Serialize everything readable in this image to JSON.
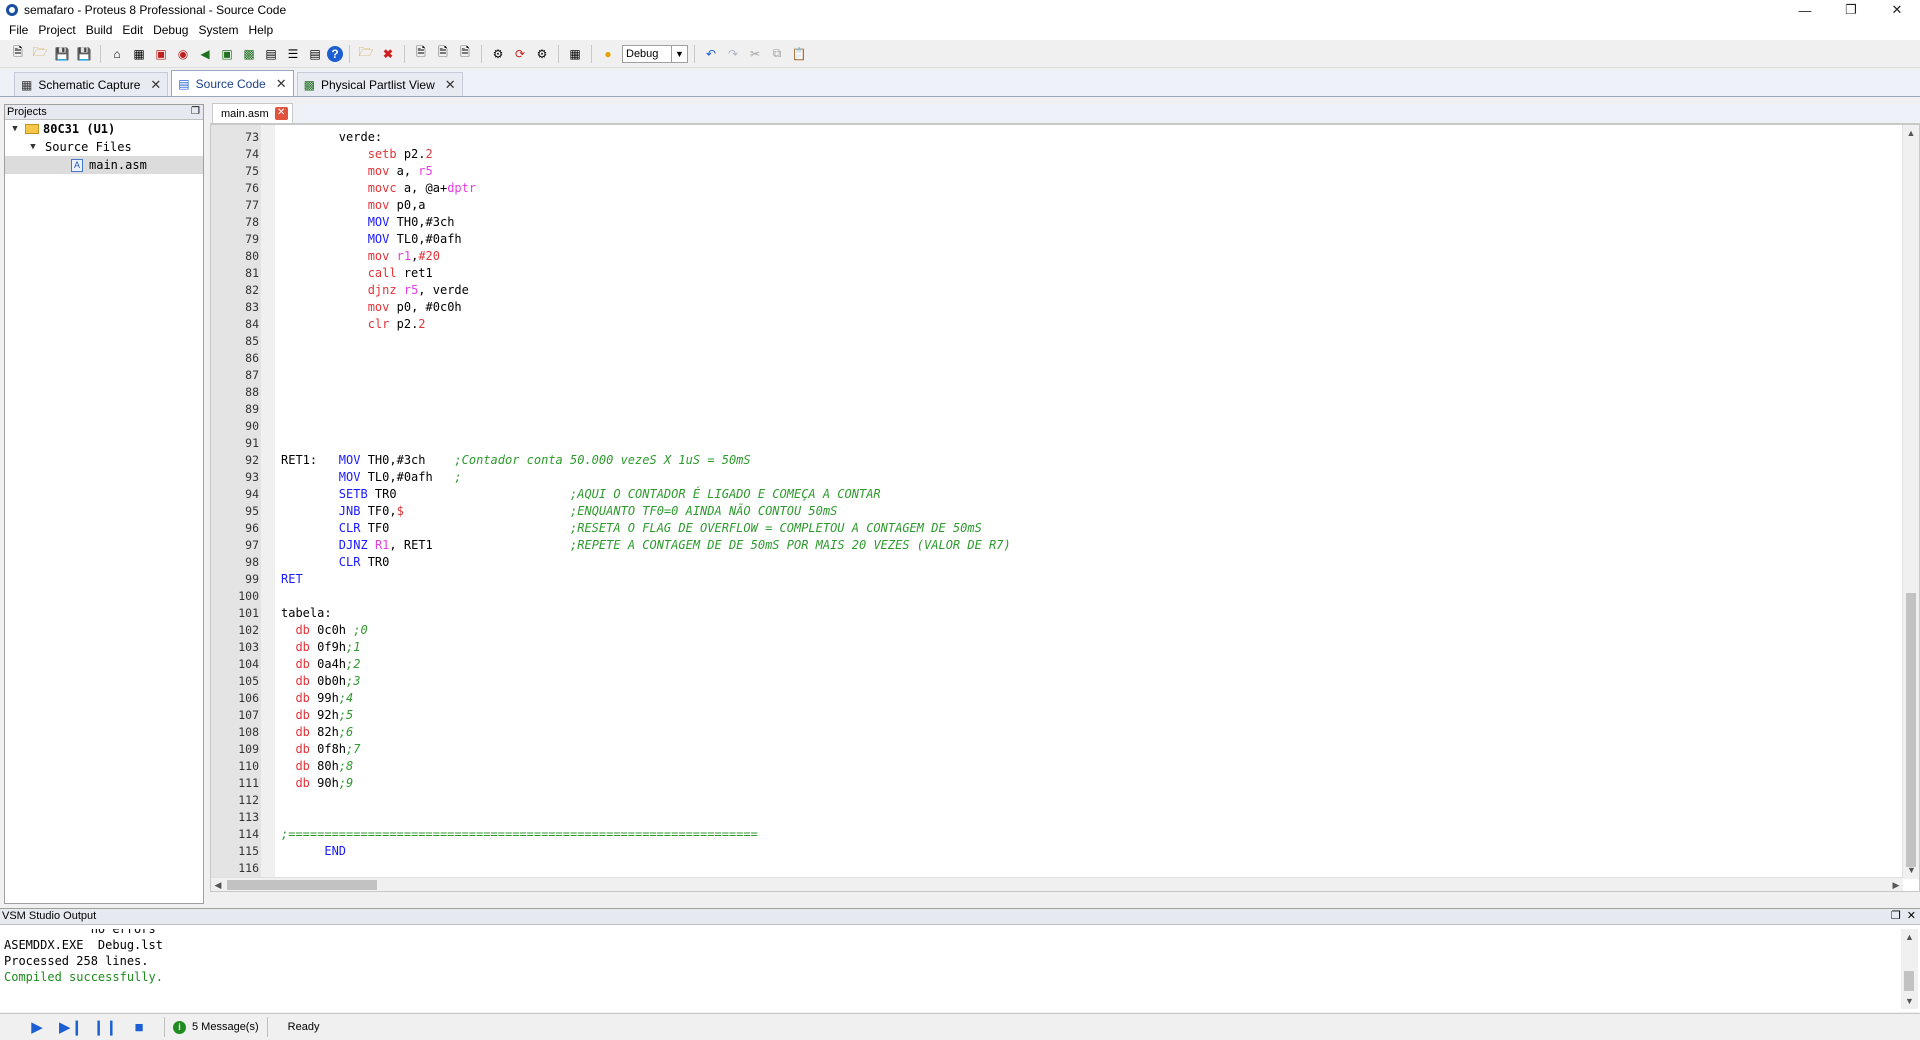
{
  "window": {
    "title": "semafaro - Proteus 8 Professional - Source Code"
  },
  "menu": [
    "File",
    "Project",
    "Build",
    "Edit",
    "Debug",
    "System",
    "Help"
  ],
  "toolbar": {
    "build_config": "Debug"
  },
  "doc_tabs": [
    {
      "label": "Schematic Capture",
      "active": false
    },
    {
      "label": "Source Code",
      "active": true
    },
    {
      "label": "Physical Partlist View",
      "active": false
    }
  ],
  "projects": {
    "header": "Projects",
    "tree": [
      {
        "label": "80C31 (U1)",
        "level": 0,
        "type": "folder"
      },
      {
        "label": "Source Files",
        "level": 1,
        "type": "group"
      },
      {
        "label": "main.asm",
        "level": 2,
        "type": "file"
      }
    ]
  },
  "editor": {
    "file_tab": "main.asm",
    "lines": [
      {
        "n": "73",
        "t": "        verde:"
      },
      {
        "n": "74",
        "t": "            setb p2.2"
      },
      {
        "n": "75",
        "t": "            mov a, r5"
      },
      {
        "n": "76",
        "t": "            movc a, @a+dptr"
      },
      {
        "n": "77",
        "t": "            mov p0,a"
      },
      {
        "n": "78",
        "t": "            MOV TH0,#3ch"
      },
      {
        "n": "79",
        "t": "            MOV TL0,#0afh"
      },
      {
        "n": "80",
        "t": "            mov r1,#20"
      },
      {
        "n": "81",
        "t": "            call ret1"
      },
      {
        "n": "82",
        "t": "            djnz r5, verde"
      },
      {
        "n": "83",
        "t": "            mov p0, #0c0h"
      },
      {
        "n": "84",
        "t": "            clr p2.2"
      },
      {
        "n": "85",
        "t": ""
      },
      {
        "n": "86",
        "t": ""
      },
      {
        "n": "87",
        "t": ""
      },
      {
        "n": "88",
        "t": ""
      },
      {
        "n": "89",
        "t": ""
      },
      {
        "n": "90",
        "t": ""
      },
      {
        "n": "91",
        "t": ""
      },
      {
        "n": "92",
        "t": "RET1:   MOV TH0,#3ch    ;Contador conta 50.000 vezeS X 1uS = 50mS"
      },
      {
        "n": "93",
        "t": "        MOV TL0,#0afh   ;"
      },
      {
        "n": "94",
        "t": "        SETB TR0                        ;AQUI O CONTADOR É LIGADO E COMEÇA A CONTAR"
      },
      {
        "n": "95",
        "t": "        JNB TF0,$                       ;ENQUANTO TF0=0 AINDA NÃO CONTOU 50mS"
      },
      {
        "n": "96",
        "t": "        CLR TF0                         ;RESETA O FLAG DE OVERFLOW = COMPLETOU A CONTAGEM DE 50mS"
      },
      {
        "n": "97",
        "t": "        DJNZ R1, RET1                   ;REPETE A CONTAGEM DE DE 50mS POR MAIS 20 VEZES (VALOR DE R7)"
      },
      {
        "n": "98",
        "t": "        CLR TR0"
      },
      {
        "n": "99",
        "t": "RET"
      },
      {
        "n": "100",
        "t": ""
      },
      {
        "n": "101",
        "t": "tabela:"
      },
      {
        "n": "102",
        "t": "  db 0c0h ;0"
      },
      {
        "n": "103",
        "t": "  db 0f9h;1"
      },
      {
        "n": "104",
        "t": "  db 0a4h;2"
      },
      {
        "n": "105",
        "t": "  db 0b0h;3"
      },
      {
        "n": "106",
        "t": "  db 99h;4"
      },
      {
        "n": "107",
        "t": "  db 92h;5"
      },
      {
        "n": "108",
        "t": "  db 82h;6"
      },
      {
        "n": "109",
        "t": "  db 0f8h;7"
      },
      {
        "n": "110",
        "t": "  db 80h;8"
      },
      {
        "n": "111",
        "t": "  db 90h;9"
      },
      {
        "n": "112",
        "t": ""
      },
      {
        "n": "113",
        "t": ""
      },
      {
        "n": "114",
        "t": ";================================================================="
      },
      {
        "n": "115",
        "t": "      END"
      },
      {
        "n": "116",
        "t": ""
      }
    ]
  },
  "output": {
    "header": "VSM Studio Output",
    "lines": [
      {
        "text": "            no errors",
        "style": "cut"
      },
      {
        "text": "ASEMDDX.EXE  Debug.lst",
        "style": ""
      },
      {
        "text": "Processed 258 lines.",
        "style": ""
      },
      {
        "text": "Compiled successfully.",
        "style": "green"
      }
    ]
  },
  "status": {
    "messages": "5 Message(s)",
    "text": "Ready"
  },
  "colors": {
    "keyword": "#1a1aff",
    "register": "#e0343a",
    "dptr": "#e23ee0",
    "comment": "#2e9a2e"
  }
}
